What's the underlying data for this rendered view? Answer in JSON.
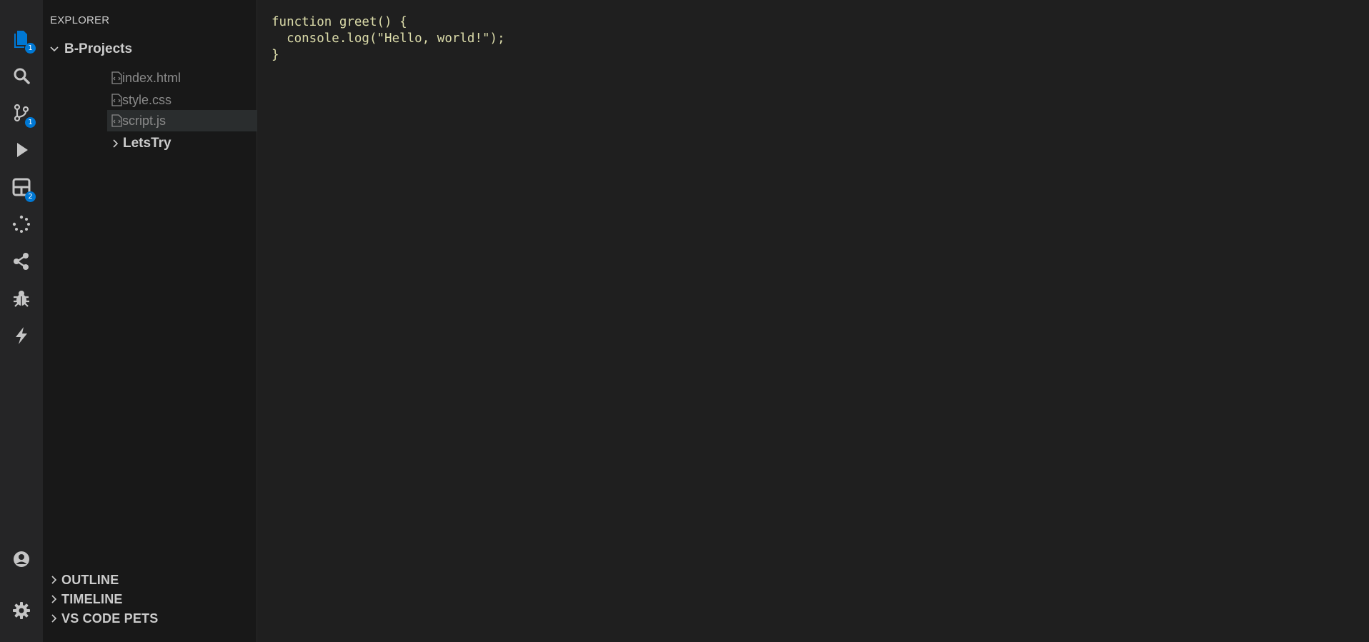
{
  "activity_bar": {
    "items": [
      {
        "name": "explorer",
        "badge": "1"
      },
      {
        "name": "search",
        "badge": ""
      },
      {
        "name": "source-control",
        "badge": "1"
      },
      {
        "name": "run-debug",
        "badge": ""
      },
      {
        "name": "extensions",
        "badge": "2"
      },
      {
        "name": "loading",
        "badge": ""
      },
      {
        "name": "live-share",
        "badge": ""
      },
      {
        "name": "debug-bug",
        "badge": ""
      },
      {
        "name": "lightning",
        "badge": ""
      }
    ],
    "accent_color": "#0078d4"
  },
  "sidebar": {
    "title": "EXPLORER",
    "folder": "B-Projects",
    "files": [
      {
        "name": "index.html",
        "selected": false
      },
      {
        "name": "style.css",
        "selected": false
      },
      {
        "name": "script.js",
        "selected": true
      }
    ],
    "subfolder": "LetsTry",
    "sections": [
      "OUTLINE",
      "TIMELINE",
      "VS CODE PETS"
    ]
  },
  "editor": {
    "lines": [
      "function greet() {",
      "  console.log(\"Hello, world!\");",
      "}"
    ],
    "text_color": "#dcdcaa"
  }
}
